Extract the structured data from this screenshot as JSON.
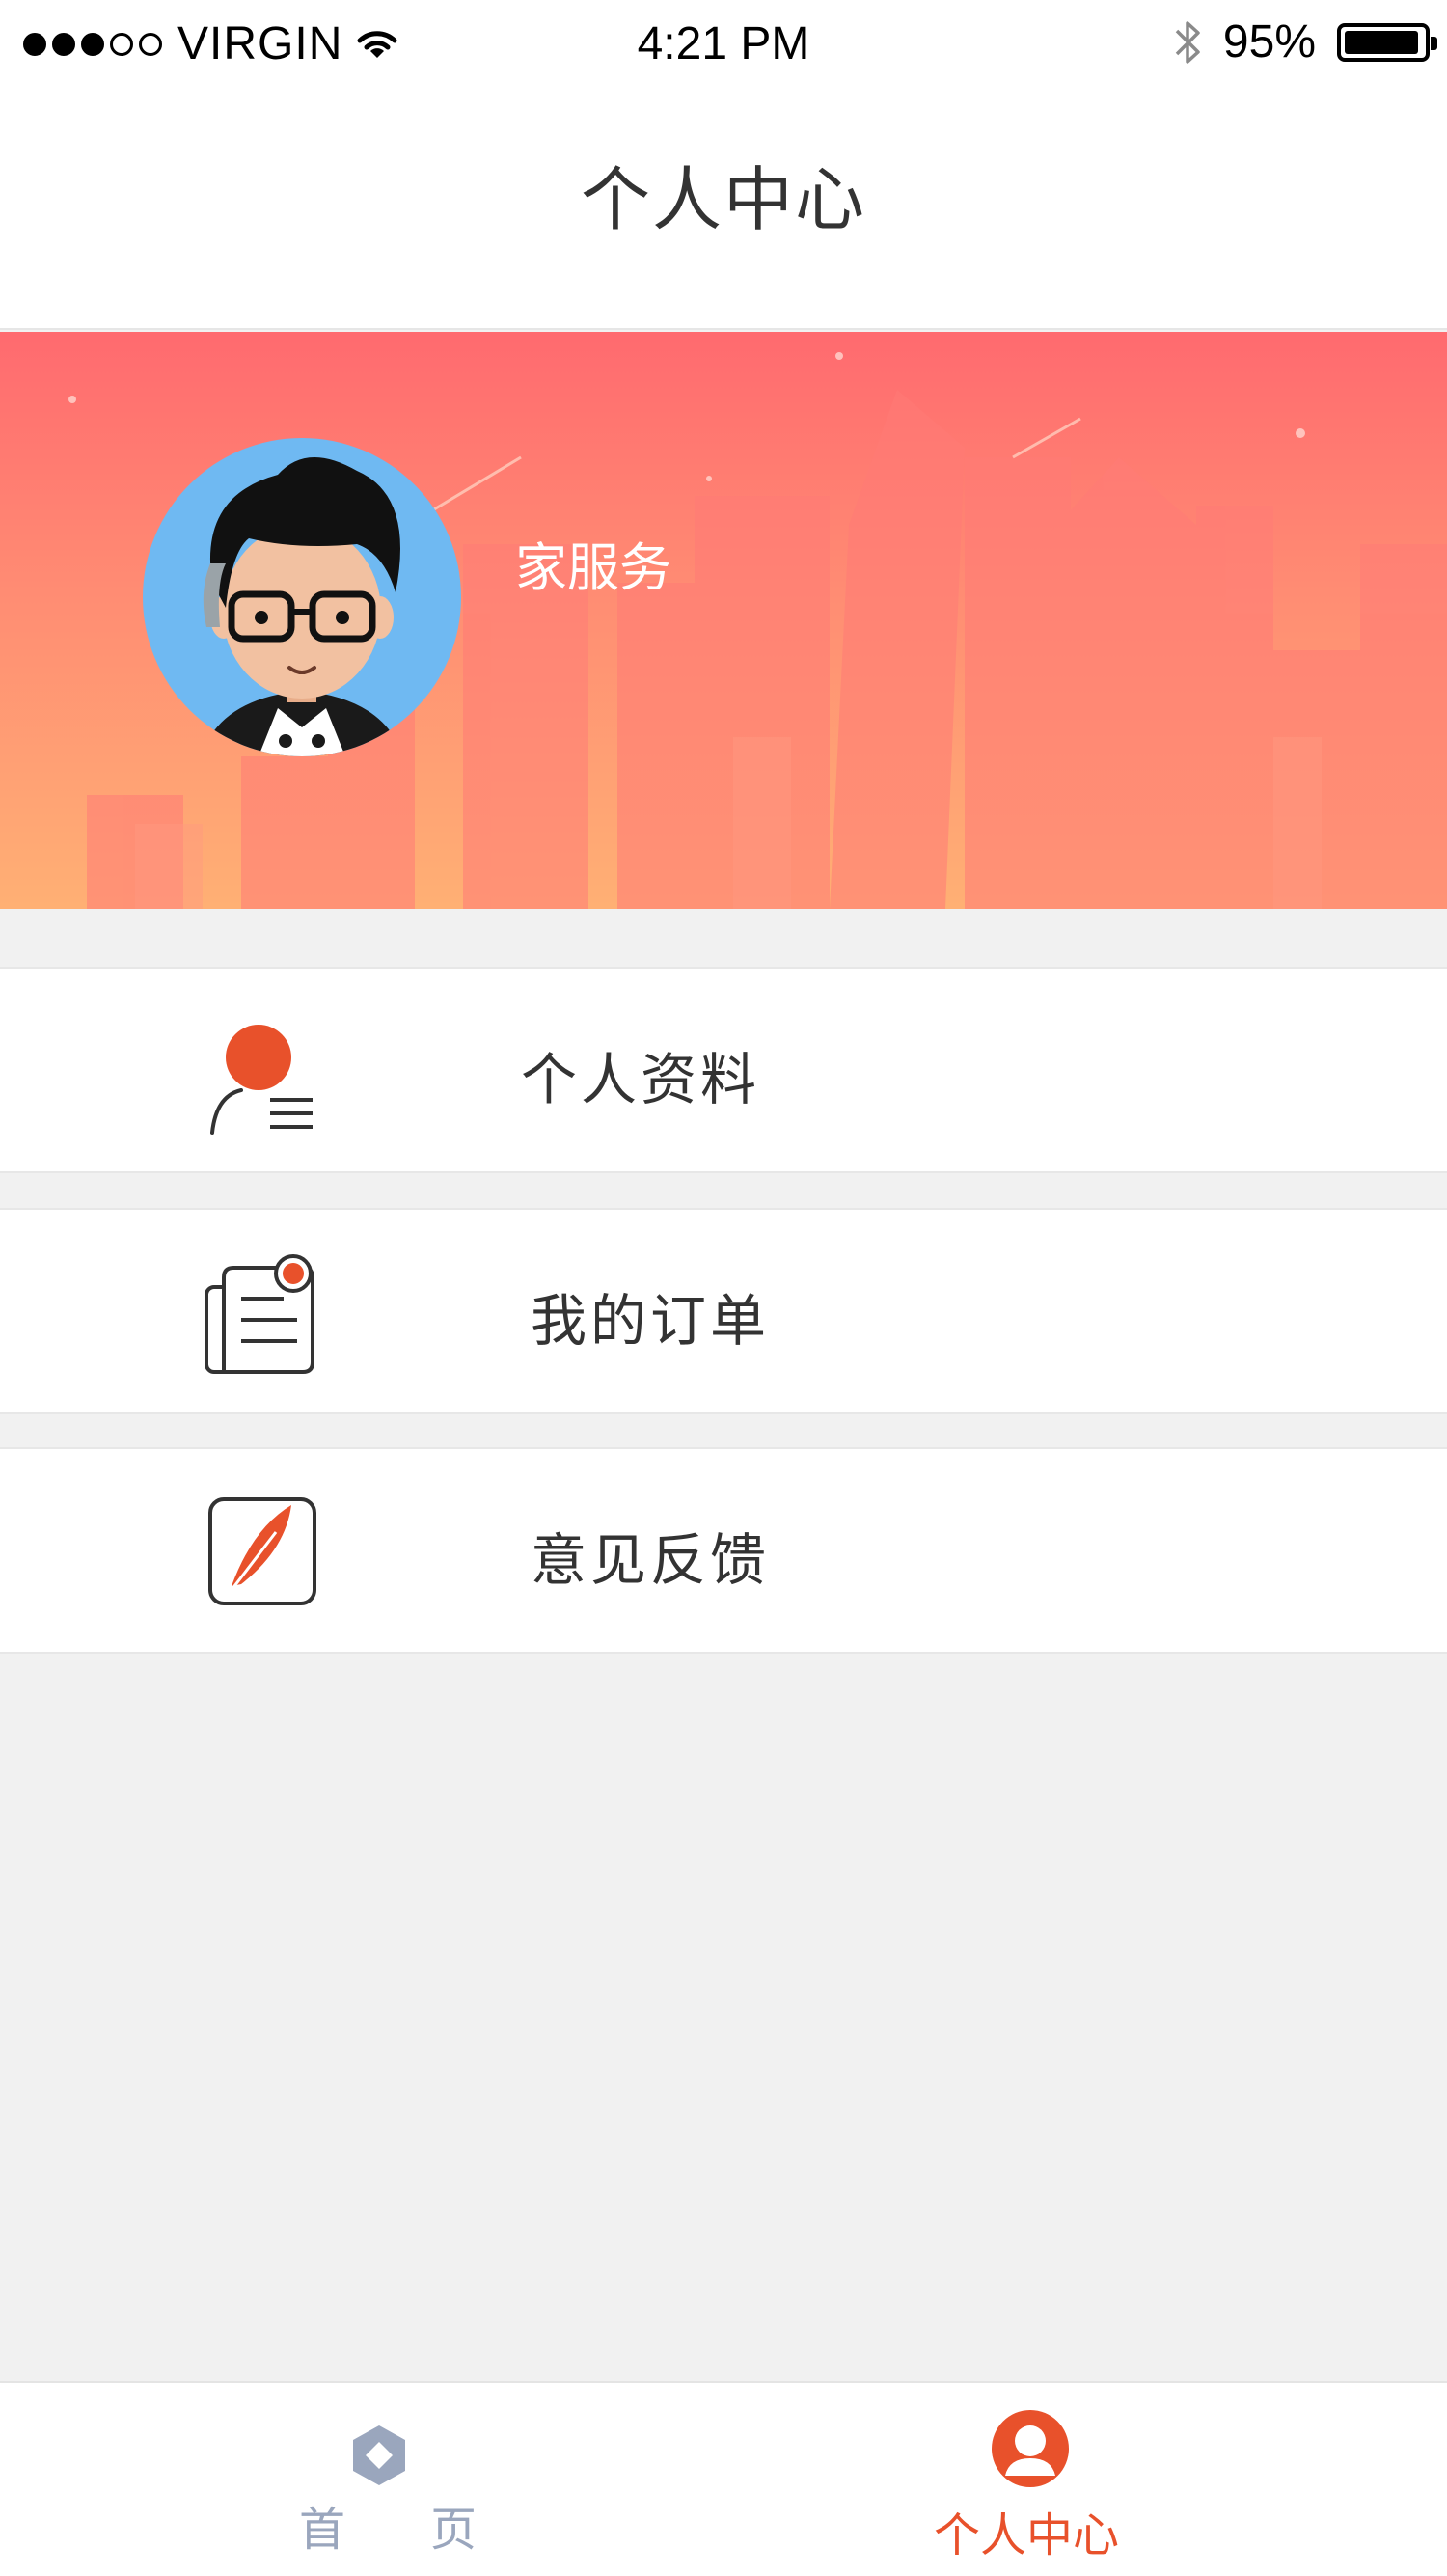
{
  "status_bar": {
    "carrier": "VIRGIN",
    "time": "4:21 PM",
    "battery": "95%",
    "battery_level": 0.95,
    "signal_bars": 3,
    "signal_total": 5,
    "icons": [
      "signal-dots-icon",
      "wifi-icon",
      "bluetooth-icon",
      "battery-icon"
    ]
  },
  "header": {
    "title": "个人中心"
  },
  "profile": {
    "name": "家服务",
    "avatar": "cartoon-avatar"
  },
  "menu": [
    {
      "label": "个人资料",
      "icon": "profile-icon"
    },
    {
      "label": "我的订单",
      "icon": "order-icon"
    },
    {
      "label": "意见反馈",
      "icon": "feedback-icon"
    }
  ],
  "tab_bar": {
    "home": {
      "label": "首　页",
      "icon": "home-icon",
      "active": false
    },
    "profile": {
      "label": "个人中心",
      "icon": "user-icon",
      "active": true
    }
  },
  "colors": {
    "accent": "#e8512b",
    "banner_top": "#ff6a6f",
    "banner_bottom": "#ffb074",
    "inactive_tab": "#9aa6bd"
  }
}
